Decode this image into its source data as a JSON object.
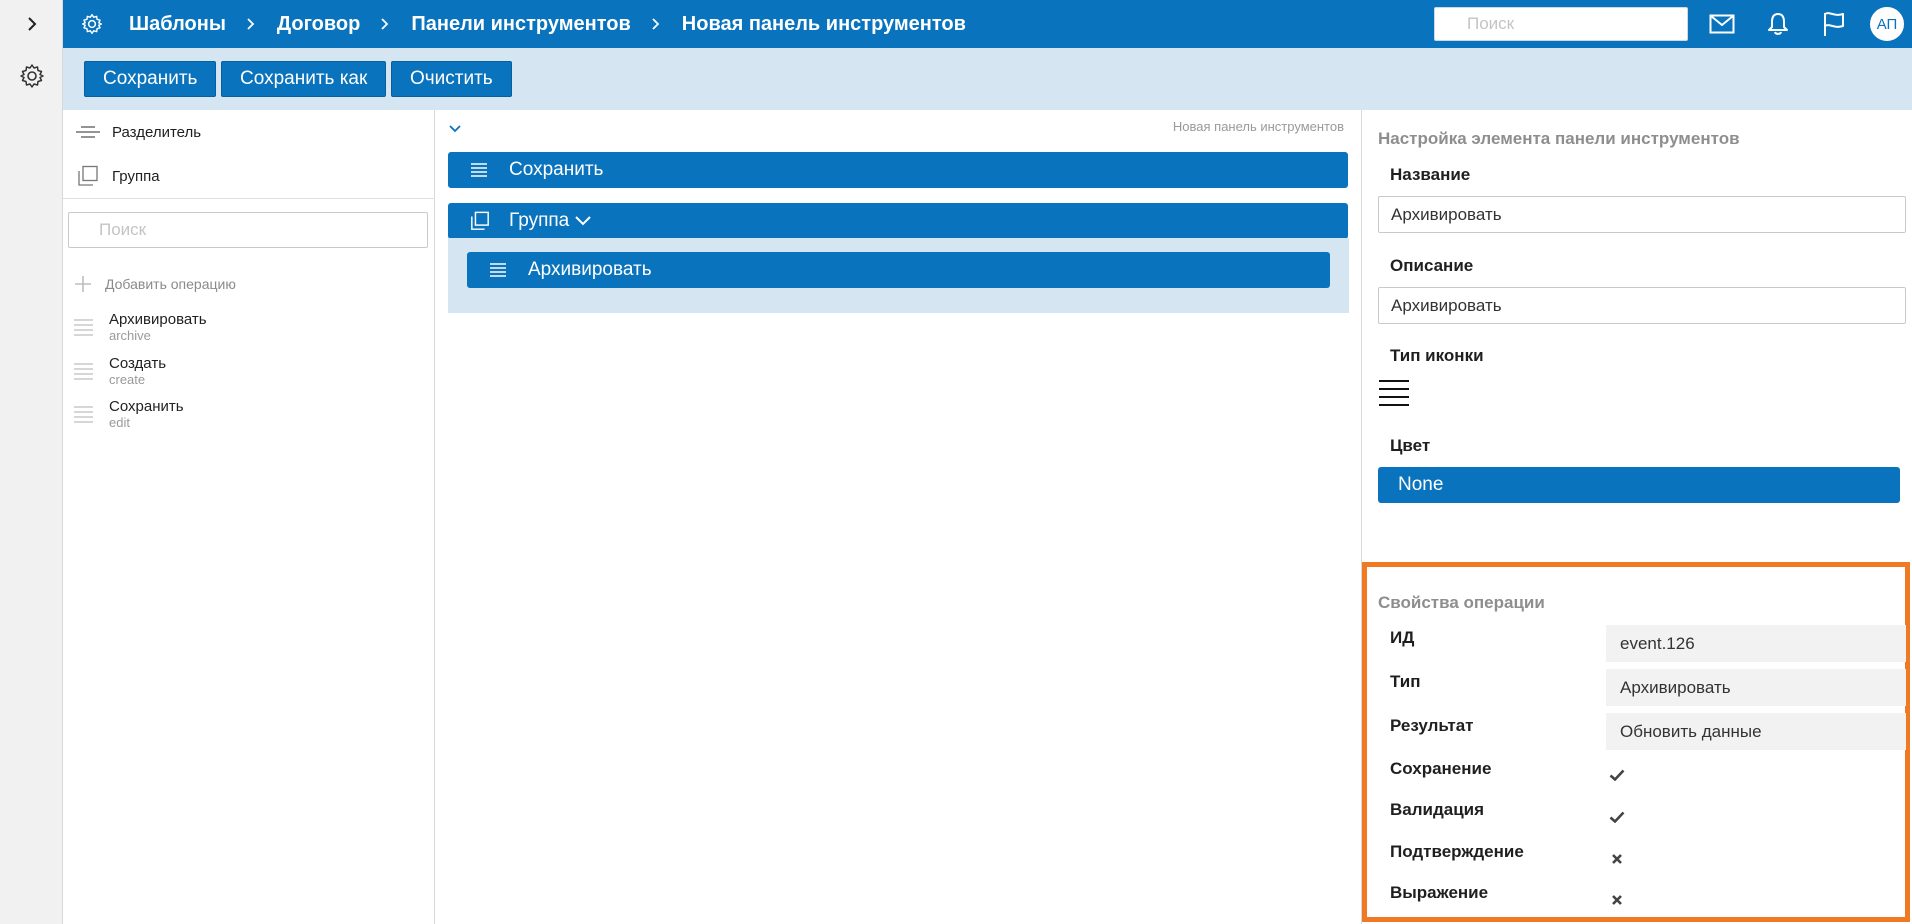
{
  "header": {
    "breadcrumbs": [
      "Шаблоны",
      "Договор",
      "Панели инструментов",
      "Новая панель инструментов"
    ],
    "search_placeholder": "Поиск",
    "avatar": "АП"
  },
  "toolbar": {
    "save_label": "Сохранить",
    "save_as_label": "Сохранить как",
    "clear_label": "Очистить"
  },
  "left": {
    "tools": [
      {
        "label": "Разделитель",
        "icon": "separator-icon"
      },
      {
        "label": "Группа",
        "icon": "group-icon"
      }
    ],
    "search_placeholder": "Поиск",
    "add_operation": "Добавить операцию",
    "operations": [
      {
        "title": "Архивировать",
        "code": "archive"
      },
      {
        "title": "Создать",
        "code": "create"
      },
      {
        "title": "Сохранить",
        "code": "edit"
      }
    ]
  },
  "middle": {
    "panel_title": "Новая панель инструментов",
    "items": {
      "save": "Сохранить",
      "group": "Группа",
      "archive": "Архивировать"
    }
  },
  "right": {
    "settings_title": "Настройка элемента панели инструментов",
    "name_label": "Название",
    "name_value": "Архивировать",
    "description_label": "Описание",
    "description_value": "Архивировать",
    "icon_type_label": "Тип иконки",
    "icon_type": "lines-icon",
    "color_label": "Цвет",
    "color_value": "None",
    "props_title": "Свойства операции",
    "props": {
      "id_label": "ИД",
      "id_value": "event.126",
      "type_label": "Тип",
      "type_value": "Архивировать",
      "result_label": "Результат",
      "result_value": "Обновить данные",
      "save_label": "Сохранение",
      "save_checked": true,
      "validation_label": "Валидация",
      "validation_checked": true,
      "confirm_label": "Подтверждение",
      "confirm_checked": false,
      "expression_label": "Выражение",
      "expression_checked": false
    }
  },
  "colors": {
    "primary": "#0973bd",
    "toolbar_bg": "#d5e6f2",
    "highlight": "#f07a24"
  }
}
